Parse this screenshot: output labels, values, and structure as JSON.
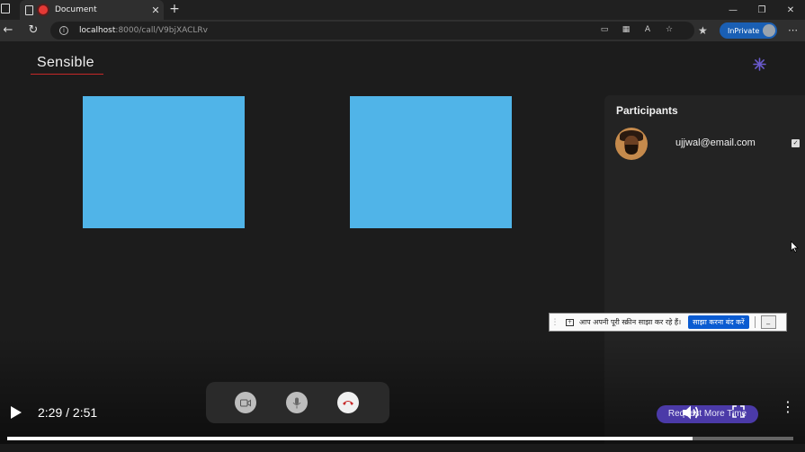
{
  "browser": {
    "tab_title": "Document",
    "tab_close": "✕",
    "new_tab": "+",
    "url_host": "localhost",
    "url_path": ":8000/call/V9bjXACLRv",
    "inprivate_label": "InPrivate",
    "window_controls": [
      "—",
      "❐",
      "✕"
    ]
  },
  "app": {
    "brand": "Sensible",
    "accent_color": "#c62828",
    "tile_color": "#50b4e8"
  },
  "participants": {
    "title": "Participants",
    "items": [
      {
        "email": "ujjwal@email.com",
        "checked": true
      }
    ]
  },
  "screen_share": {
    "message": "आप अपनी पूरी स्क्रीन साझा कर रहे हैं।",
    "stop_label": "साझा करना बंद करें",
    "hide_label": "_"
  },
  "call_controls": {
    "request_button": "Request More Time"
  },
  "video_player": {
    "time": "2:29 / 2:51",
    "progress": 0.872
  }
}
